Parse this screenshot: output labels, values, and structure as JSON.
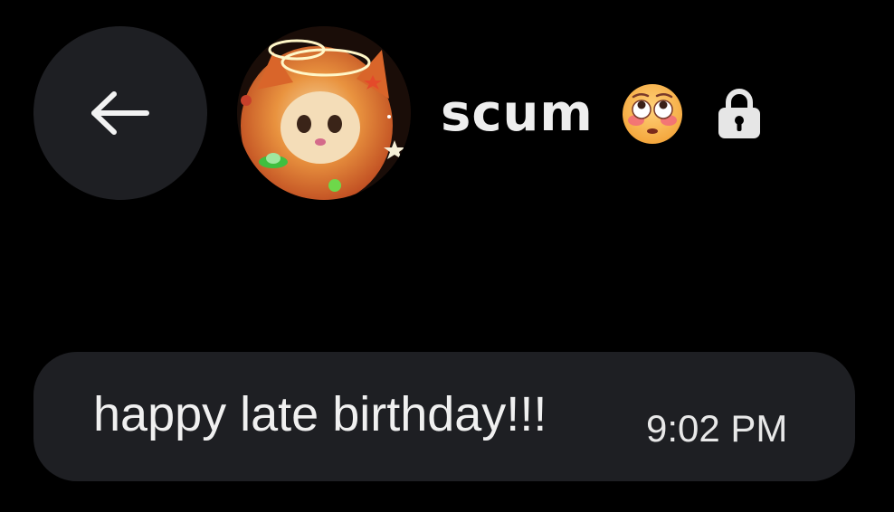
{
  "header": {
    "back_icon": "arrow-left-icon",
    "avatar_description_icon": "cat-avatar",
    "contact_name": "scum",
    "status_emoji_icon": "flushed-face-emoji-icon",
    "lock_icon": "lock-icon"
  },
  "messages": [
    {
      "text": "happy late birthday!!!",
      "time": "9:02 PM"
    }
  ],
  "colors": {
    "background": "#000000",
    "bubble": "#1e1f23",
    "text": "#f0f0f0",
    "lock": "#e6e6e6"
  }
}
